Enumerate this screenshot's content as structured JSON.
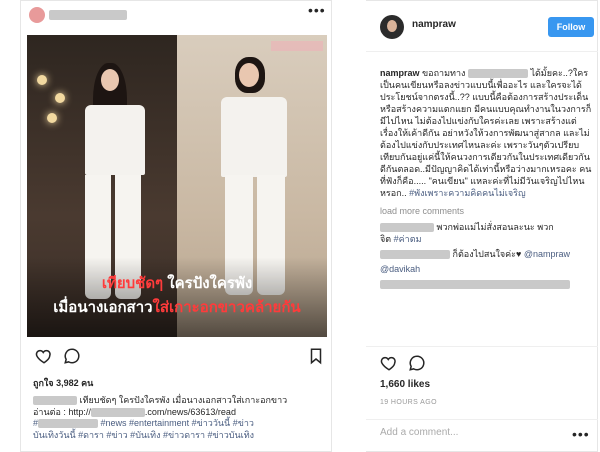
{
  "left_post": {
    "caption_line1": "เทียบชัดๆ",
    "caption_line1_rest": "ใครปังใครพัง",
    "caption_line2_white": "เมื่อนางเอกสาว",
    "caption_line2_red": "ใส่เกาะอกขาวคล้ายกัน",
    "likes": "ถูกใจ 3,982 คน",
    "caption_text_a": "เทียบชัดๆ  ใครปังใครพัง  เมื่อนางเอกสาวใส่เกาะอกขาว",
    "caption_text_b": "อ่านต่อ : http://",
    "caption_text_c": ".com/news/63613/read",
    "caption_tag_a": "#",
    "caption_tags_1": "#news #entertainment #ข่าววันนี้ #ข่าว",
    "caption_tags_2": "บันเทิงวันนี้ #ดารา #ข่าว #บันเทิง #ข่าวดารา #ข่าวบันเทิง"
  },
  "right_panel": {
    "username": "nampraw",
    "follow_label": "Follow",
    "comment_main_a": "ขอถามทาง",
    "comment_main_b": "ได้มั้ยคะ..?ใครเป็นคนเขียนหรือลงข่าวแบบนี้เพื่ออะไร และใครจะได้ประโยชน์จากตรงนี้..?? แบบนี้คือต้องการสร้างประเด็น หรือสร้างความแตกแยก มีคนแบบคุณทำงานในวงการก็มีไปไหน ไม่ต้องไปแข่งกับใครค่ะเลย เพราะสร้างแต่เรื่องให้เค้าดีกัน อย่าหวังให้วงการพัฒนาสู่สากล และไม่ต้องไปแข่งกับประเทศไหนละค่ะ เพราะวันๆตัวเปรียบเทียบกันอยู่แค่นี้ให้คนวงการเดียวกันในประเทศเดียวกันดีกันตลอด..มีปัญญาคิดได้เท่านี้หรือว่างมากเหรอคะ คนที่ฟังก็คือ.....",
    "comment_main_c": "\"คนเขียน\" แหละค่ะที่ไม่มีวันเจริญไปไหนหรอก..",
    "comment_main_tag": "#พังเพราะความคิดคนไม่เจริญ",
    "load_more": "load more comments",
    "c1_text": "พวกพ่อแม่ไม่สั่งสอนละนะ พวก",
    "c1_text2": "จิต",
    "c1_tag": "#ค่าตม",
    "c2_text": "ก็ต้องไปสนใจค่ะ",
    "c2_tag": "@nampraw",
    "c3_tag": "@davikah",
    "likes": "1,660 likes",
    "time": "19 HOURS AGO",
    "add_comment_placeholder": "Add a comment..."
  }
}
